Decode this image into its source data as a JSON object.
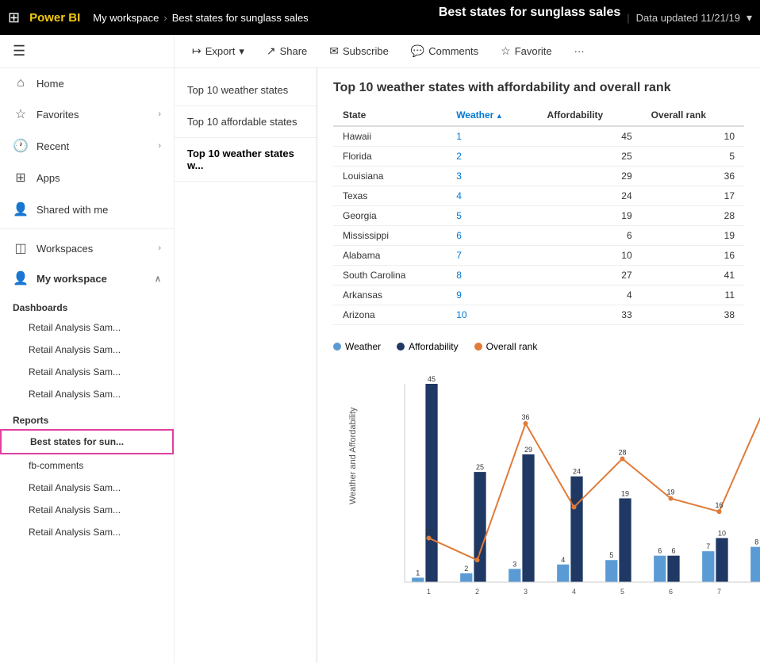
{
  "topnav": {
    "logo": "Power BI",
    "workspace": "My workspace",
    "separator": ">",
    "report": "Best states for sunglass sales",
    "center_title": "Best states for sunglass sales",
    "divider": "|",
    "data_updated": "Data updated 11/21/19"
  },
  "toolbar": {
    "export_label": "Export",
    "share_label": "Share",
    "subscribe_label": "Subscribe",
    "comments_label": "Comments",
    "favorite_label": "Favorite",
    "more_label": "···"
  },
  "sidebar": {
    "home_label": "Home",
    "favorites_label": "Favorites",
    "recent_label": "Recent",
    "apps_label": "Apps",
    "shared_label": "Shared with me",
    "workspaces_label": "Workspaces",
    "my_workspace_label": "My workspace",
    "dashboards_section": "Dashboards",
    "dashboard_items": [
      "Retail Analysis Sam...",
      "Retail Analysis Sam...",
      "Retail Analysis Sam...",
      "Retail Analysis Sam..."
    ],
    "reports_section": "Reports",
    "report_items": [
      "Best states for sun...",
      "fb-comments",
      "Retail Analysis Sam...",
      "Retail Analysis Sam...",
      "Retail Analysis Sam..."
    ]
  },
  "report_pages": [
    {
      "label": "Top 10 weather states",
      "active": false
    },
    {
      "label": "Top 10 affordable states",
      "active": false
    },
    {
      "label": "Top 10 weather states w...",
      "active": true
    }
  ],
  "report": {
    "title": "Top 10 weather states with affordability and overall rank",
    "table": {
      "columns": [
        "State",
        "Weather",
        "Affordability",
        "Overall rank"
      ],
      "sorted_col": "Weather",
      "rows": [
        {
          "state": "Hawaii",
          "weather": 1,
          "affordability": 45,
          "overall": 10
        },
        {
          "state": "Florida",
          "weather": 2,
          "affordability": 25,
          "overall": 5
        },
        {
          "state": "Louisiana",
          "weather": 3,
          "affordability": 29,
          "overall": 36
        },
        {
          "state": "Texas",
          "weather": 4,
          "affordability": 24,
          "overall": 17
        },
        {
          "state": "Georgia",
          "weather": 5,
          "affordability": 19,
          "overall": 28
        },
        {
          "state": "Mississippi",
          "weather": 6,
          "affordability": 6,
          "overall": 19
        },
        {
          "state": "Alabama",
          "weather": 7,
          "affordability": 10,
          "overall": 16
        },
        {
          "state": "South Carolina",
          "weather": 8,
          "affordability": 27,
          "overall": 41
        },
        {
          "state": "Arkansas",
          "weather": 9,
          "affordability": 4,
          "overall": 11
        },
        {
          "state": "Arizona",
          "weather": 10,
          "affordability": 33,
          "overall": 38
        }
      ]
    },
    "legend": {
      "weather_label": "Weather",
      "affordability_label": "Affordability",
      "overall_label": "Overall rank",
      "weather_color": "#5b9bd5",
      "affordability_color": "#1f3864",
      "overall_color": "#e07b3a"
    },
    "chart_y_label": "Weather and Affordability"
  }
}
